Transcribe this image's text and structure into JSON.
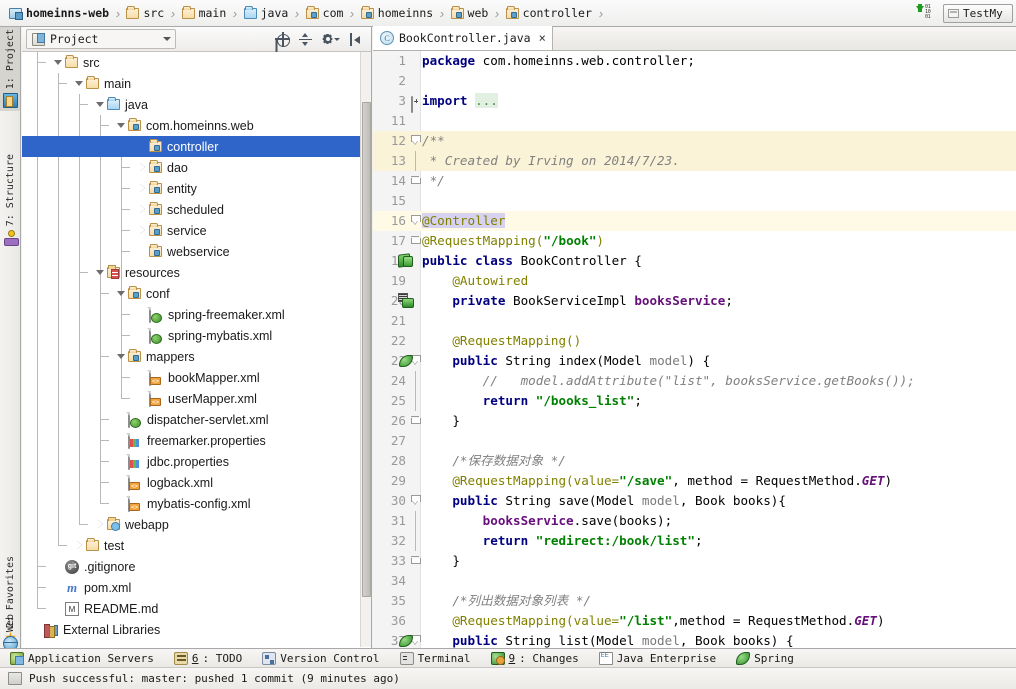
{
  "breadcrumb": {
    "items": [
      {
        "label": "homeinns-web",
        "icon": "module-icon",
        "bold": true
      },
      {
        "label": "src",
        "icon": "folder-icon"
      },
      {
        "label": "main",
        "icon": "folder-icon"
      },
      {
        "label": "java",
        "icon": "source-folder-icon"
      },
      {
        "label": "com",
        "icon": "package-icon"
      },
      {
        "label": "homeinns",
        "icon": "package-icon"
      },
      {
        "label": "web",
        "icon": "package-icon"
      },
      {
        "label": "controller",
        "icon": "package-icon"
      }
    ],
    "separator": "›",
    "right": {
      "download_icon": "download-bits-icon",
      "run_config_label": "TestMy",
      "run_config_icon": "run-config-icon"
    }
  },
  "tool_tabs": [
    {
      "label": "1: Project",
      "icon": "project-icon",
      "active": true
    },
    {
      "label": "7: Structure",
      "icon": "structure-icon",
      "active": false
    },
    {
      "label": "2: Favorites",
      "icon": "star-icon",
      "active": false
    },
    {
      "label": "Web",
      "icon": "web-icon",
      "active": false
    }
  ],
  "project_panel": {
    "title": "Project",
    "title_icon": "project-view-icon",
    "toolbar": [
      {
        "name": "locate-in-tree-icon",
        "label": "Select Opened File"
      },
      {
        "name": "collapse-all-icon",
        "label": "Collapse All"
      },
      {
        "name": "settings-gear-icon",
        "label": "Settings"
      },
      {
        "name": "hide-panel-icon",
        "label": "Hide"
      }
    ],
    "tree": [
      {
        "label": "src",
        "indent": 1,
        "icon": "folder-icon",
        "arrow": "expanded",
        "selected": false
      },
      {
        "label": "main",
        "indent": 2,
        "icon": "folder-icon",
        "arrow": "expanded",
        "selected": false
      },
      {
        "label": "java",
        "indent": 3,
        "icon": "source-folder-icon",
        "arrow": "expanded",
        "selected": false
      },
      {
        "label": "com.homeinns.web",
        "indent": 4,
        "icon": "package-icon",
        "arrow": "expanded",
        "selected": false
      },
      {
        "label": "controller",
        "indent": 5,
        "icon": "package-icon",
        "arrow": "none",
        "selected": true
      },
      {
        "label": "dao",
        "indent": 5,
        "icon": "package-icon",
        "arrow": "collapsed",
        "selected": false
      },
      {
        "label": "entity",
        "indent": 5,
        "icon": "package-icon",
        "arrow": "collapsed",
        "selected": false
      },
      {
        "label": "scheduled",
        "indent": 5,
        "icon": "package-icon",
        "arrow": "collapsed",
        "selected": false
      },
      {
        "label": "service",
        "indent": 5,
        "icon": "package-icon",
        "arrow": "collapsed",
        "selected": false
      },
      {
        "label": "webservice",
        "indent": 5,
        "icon": "package-icon",
        "arrow": "none",
        "selected": false
      },
      {
        "label": "resources",
        "indent": 3,
        "icon": "resources-folder-icon",
        "arrow": "expanded",
        "selected": false
      },
      {
        "label": "conf",
        "indent": 4,
        "icon": "package-icon",
        "arrow": "expanded",
        "selected": false
      },
      {
        "label": "spring-freemaker.xml",
        "indent": 5,
        "icon": "spring-xml-icon",
        "arrow": "none",
        "selected": false
      },
      {
        "label": "spring-mybatis.xml",
        "indent": 5,
        "icon": "spring-xml-icon",
        "arrow": "none",
        "selected": false
      },
      {
        "label": "mappers",
        "indent": 4,
        "icon": "package-icon",
        "arrow": "expanded",
        "selected": false
      },
      {
        "label": "bookMapper.xml",
        "indent": 5,
        "icon": "xml-icon",
        "arrow": "none",
        "selected": false
      },
      {
        "label": "userMapper.xml",
        "indent": 5,
        "icon": "xml-icon",
        "arrow": "none",
        "selected": false
      },
      {
        "label": "dispatcher-servlet.xml",
        "indent": 4,
        "icon": "spring-xml-icon",
        "arrow": "none",
        "selected": false
      },
      {
        "label": "freemarker.properties",
        "indent": 4,
        "icon": "properties-icon",
        "arrow": "none",
        "selected": false
      },
      {
        "label": "jdbc.properties",
        "indent": 4,
        "icon": "properties-icon",
        "arrow": "none",
        "selected": false
      },
      {
        "label": "logback.xml",
        "indent": 4,
        "icon": "xml-icon",
        "arrow": "none",
        "selected": false
      },
      {
        "label": "mybatis-config.xml",
        "indent": 4,
        "icon": "xml-icon",
        "arrow": "none",
        "selected": false
      },
      {
        "label": "webapp",
        "indent": 3,
        "icon": "webapp-folder-icon",
        "arrow": "collapsed",
        "selected": false
      },
      {
        "label": "test",
        "indent": 2,
        "icon": "folder-icon",
        "arrow": "collapsed",
        "selected": false
      },
      {
        "label": ".gitignore",
        "indent": 1,
        "icon": "git-icon",
        "arrow": "none",
        "selected": false
      },
      {
        "label": "pom.xml",
        "indent": 1,
        "icon": "maven-icon",
        "arrow": "none",
        "selected": false
      },
      {
        "label": "README.md",
        "indent": 1,
        "icon": "markdown-icon",
        "arrow": "none",
        "selected": false
      },
      {
        "label": "External Libraries",
        "indent": 0,
        "icon": "libraries-icon",
        "arrow": "none",
        "selected": false
      }
    ]
  },
  "editor": {
    "tab": {
      "label": "BookController.java",
      "icon": "java-class-icon",
      "close": "×"
    },
    "lines": [
      {
        "no": "1",
        "fold": "none",
        "highlight": "none",
        "segments": [
          {
            "t": "package ",
            "c": "kw"
          },
          {
            "t": "com.homeinns.web.controller;",
            "c": "plain"
          }
        ],
        "indent": 0
      },
      {
        "no": "2",
        "fold": "none",
        "highlight": "none",
        "segments": []
      },
      {
        "no": "3",
        "fold": "plus",
        "highlight": "none",
        "segments": [
          {
            "t": "import ",
            "c": "kw"
          },
          {
            "t": "...",
            "c": "folded"
          }
        ]
      },
      {
        "no": "11",
        "fold": "none",
        "highlight": "none",
        "segments": []
      },
      {
        "no": "12",
        "fold": "top",
        "highlight": "doc",
        "segments": [
          {
            "t": "/**",
            "c": "docc"
          }
        ]
      },
      {
        "no": "13",
        "fold": "none",
        "highlight": "doc",
        "segments": [
          {
            "t": " * Created by Irving on 2014/7/23.",
            "c": "docc"
          }
        ]
      },
      {
        "no": "14",
        "fold": "bot",
        "highlight": "none",
        "segments": [
          {
            "t": " */",
            "c": "docc"
          }
        ]
      },
      {
        "no": "15",
        "fold": "none",
        "highlight": "none",
        "segments": []
      },
      {
        "no": "16",
        "fold": "top",
        "highlight": "caret",
        "segments": [
          {
            "t": "@Controller",
            "c": "ann selhl"
          }
        ]
      },
      {
        "no": "17",
        "fold": "bot",
        "highlight": "none",
        "segments": [
          {
            "t": "@RequestMapping(",
            "c": "ann"
          },
          {
            "t": "\"/book\"",
            "c": "str"
          },
          {
            "t": ")",
            "c": "ann"
          }
        ]
      },
      {
        "no": "18",
        "fold": "none",
        "highlight": "none",
        "gutter": "spring-bean-icon",
        "segments": [
          {
            "t": "public class ",
            "c": "kw"
          },
          {
            "t": "BookController {",
            "c": "plain"
          }
        ]
      },
      {
        "no": "19",
        "fold": "none",
        "highlight": "none",
        "segments": [
          {
            "t": "    @Autowired",
            "c": "ann"
          }
        ]
      },
      {
        "no": "20",
        "fold": "none",
        "highlight": "none",
        "gutter": "spring-autowired-icon",
        "segments": [
          {
            "t": "    private ",
            "c": "kw"
          },
          {
            "t": "BookServiceImpl ",
            "c": "plain"
          },
          {
            "t": "booksService",
            "c": "fld"
          },
          {
            "t": ";",
            "c": "plain"
          }
        ]
      },
      {
        "no": "21",
        "fold": "none",
        "highlight": "none",
        "segments": []
      },
      {
        "no": "22",
        "fold": "none",
        "highlight": "none",
        "segments": [
          {
            "t": "    @RequestMapping()",
            "c": "ann"
          }
        ]
      },
      {
        "no": "23",
        "fold": "top2",
        "highlight": "none",
        "gutter": "spring-request-icon",
        "segments": [
          {
            "t": "    public ",
            "c": "kw"
          },
          {
            "t": "String ",
            "c": "plain"
          },
          {
            "t": "index(Model ",
            "c": "plain"
          },
          {
            "t": "model",
            "c": "param"
          },
          {
            "t": ") {",
            "c": "plain"
          }
        ]
      },
      {
        "no": "24",
        "fold": "none",
        "highlight": "none",
        "segments": [
          {
            "t": "        //   model.addAttribute(\"list\", booksService.getBooks());",
            "c": "cmt"
          }
        ]
      },
      {
        "no": "25",
        "fold": "none",
        "highlight": "none",
        "segments": [
          {
            "t": "        return ",
            "c": "kw"
          },
          {
            "t": "\"/books_list\"",
            "c": "str"
          },
          {
            "t": ";",
            "c": "plain"
          }
        ]
      },
      {
        "no": "26",
        "fold": "bot",
        "highlight": "none",
        "segments": [
          {
            "t": "    }",
            "c": "plain"
          }
        ]
      },
      {
        "no": "27",
        "fold": "none",
        "highlight": "none",
        "segments": []
      },
      {
        "no": "28",
        "fold": "none",
        "highlight": "none",
        "segments": [
          {
            "t": "    /*保存数据对象 */",
            "c": "cmt"
          }
        ]
      },
      {
        "no": "29",
        "fold": "none",
        "highlight": "none",
        "segments": [
          {
            "t": "    @RequestMapping(value=",
            "c": "ann"
          },
          {
            "t": "\"/save\"",
            "c": "str"
          },
          {
            "t": ", method = RequestMethod.",
            "c": "plain"
          },
          {
            "t": "GET",
            "c": "stat"
          },
          {
            "t": ")",
            "c": "plain"
          }
        ]
      },
      {
        "no": "30",
        "fold": "top2",
        "highlight": "none",
        "segments": [
          {
            "t": "    public ",
            "c": "kw"
          },
          {
            "t": "String ",
            "c": "plain"
          },
          {
            "t": "save(Model ",
            "c": "plain"
          },
          {
            "t": "model",
            "c": "param"
          },
          {
            "t": ", Book books){",
            "c": "plain"
          }
        ]
      },
      {
        "no": "31",
        "fold": "none",
        "highlight": "none",
        "segments": [
          {
            "t": "        booksService",
            "c": "fld"
          },
          {
            "t": ".save(books);",
            "c": "plain"
          }
        ]
      },
      {
        "no": "32",
        "fold": "none",
        "highlight": "none",
        "segments": [
          {
            "t": "        return ",
            "c": "kw"
          },
          {
            "t": "\"redirect:/book/list\"",
            "c": "str"
          },
          {
            "t": ";",
            "c": "plain"
          }
        ]
      },
      {
        "no": "33",
        "fold": "bot",
        "highlight": "none",
        "segments": [
          {
            "t": "    }",
            "c": "plain"
          }
        ]
      },
      {
        "no": "34",
        "fold": "none",
        "highlight": "none",
        "segments": []
      },
      {
        "no": "35",
        "fold": "none",
        "highlight": "none",
        "segments": [
          {
            "t": "    /*列出数据对象列表 */",
            "c": "cmt"
          }
        ]
      },
      {
        "no": "36",
        "fold": "none",
        "highlight": "none",
        "segments": [
          {
            "t": "    @RequestMapping(value=",
            "c": "ann"
          },
          {
            "t": "\"/list\"",
            "c": "str"
          },
          {
            "t": ",method = RequestMethod.",
            "c": "plain"
          },
          {
            "t": "GET",
            "c": "stat"
          },
          {
            "t": ")",
            "c": "plain"
          }
        ]
      },
      {
        "no": "37",
        "fold": "top2",
        "highlight": "none",
        "gutter": "spring-request-icon",
        "segments": [
          {
            "t": "    public ",
            "c": "kw"
          },
          {
            "t": "String ",
            "c": "plain"
          },
          {
            "t": "list(Model ",
            "c": "plain"
          },
          {
            "t": "model",
            "c": "param"
          },
          {
            "t": ", Book books) {",
            "c": "plain"
          }
        ]
      }
    ]
  },
  "bottom_toolbar": [
    {
      "label": "Application Servers",
      "icon": "application-servers-icon",
      "num": ""
    },
    {
      "label": ": TODO",
      "icon": "todo-icon",
      "num": "6"
    },
    {
      "label": "Version Control",
      "icon": "version-control-icon",
      "num": ""
    },
    {
      "label": "Terminal",
      "icon": "terminal-icon",
      "num": ""
    },
    {
      "label": ": Changes",
      "icon": "changes-icon",
      "num": "9"
    },
    {
      "label": "Java Enterprise",
      "icon": "java-enterprise-icon",
      "num": ""
    },
    {
      "label": "Spring",
      "icon": "spring-icon",
      "num": ""
    }
  ],
  "statusbar": {
    "icon": "status-message-icon",
    "message": "Push successful: master: pushed 1 commit  (9 minutes ago)"
  }
}
